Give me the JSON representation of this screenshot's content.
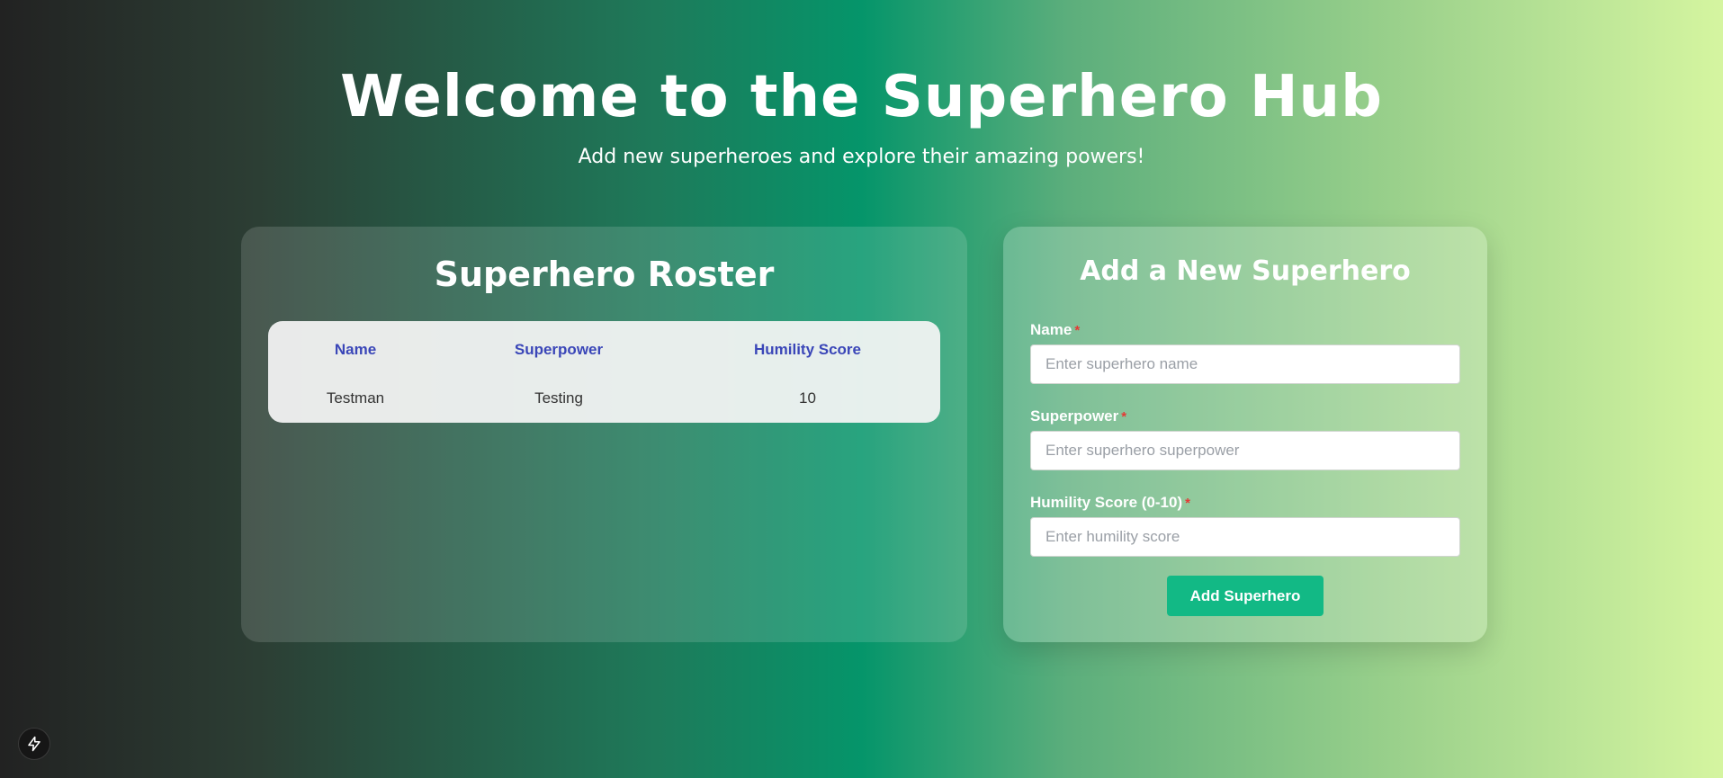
{
  "hero": {
    "title": "Welcome to the Superhero Hub",
    "subtitle": "Add new superheroes and explore their amazing powers!"
  },
  "roster": {
    "title": "Superhero Roster",
    "columns": [
      "Name",
      "Superpower",
      "Humility Score"
    ],
    "rows": [
      {
        "name": "Testman",
        "superpower": "Testing",
        "humility_score": "10"
      }
    ]
  },
  "form": {
    "title": "Add a New Superhero",
    "required_marker": "*",
    "fields": {
      "name": {
        "label": "Name",
        "placeholder": "Enter superhero name",
        "value": ""
      },
      "superpower": {
        "label": "Superpower",
        "placeholder": "Enter superhero superpower",
        "value": ""
      },
      "humility": {
        "label": "Humility Score (0-10)",
        "placeholder": "Enter humility score",
        "value": ""
      }
    },
    "submit_label": "Add Superhero"
  },
  "corner_badge": {
    "icon": "lightning-bolt-icon"
  },
  "colors": {
    "table_header": "#3a46b8",
    "required": "#e53935",
    "button": "#12b985"
  }
}
